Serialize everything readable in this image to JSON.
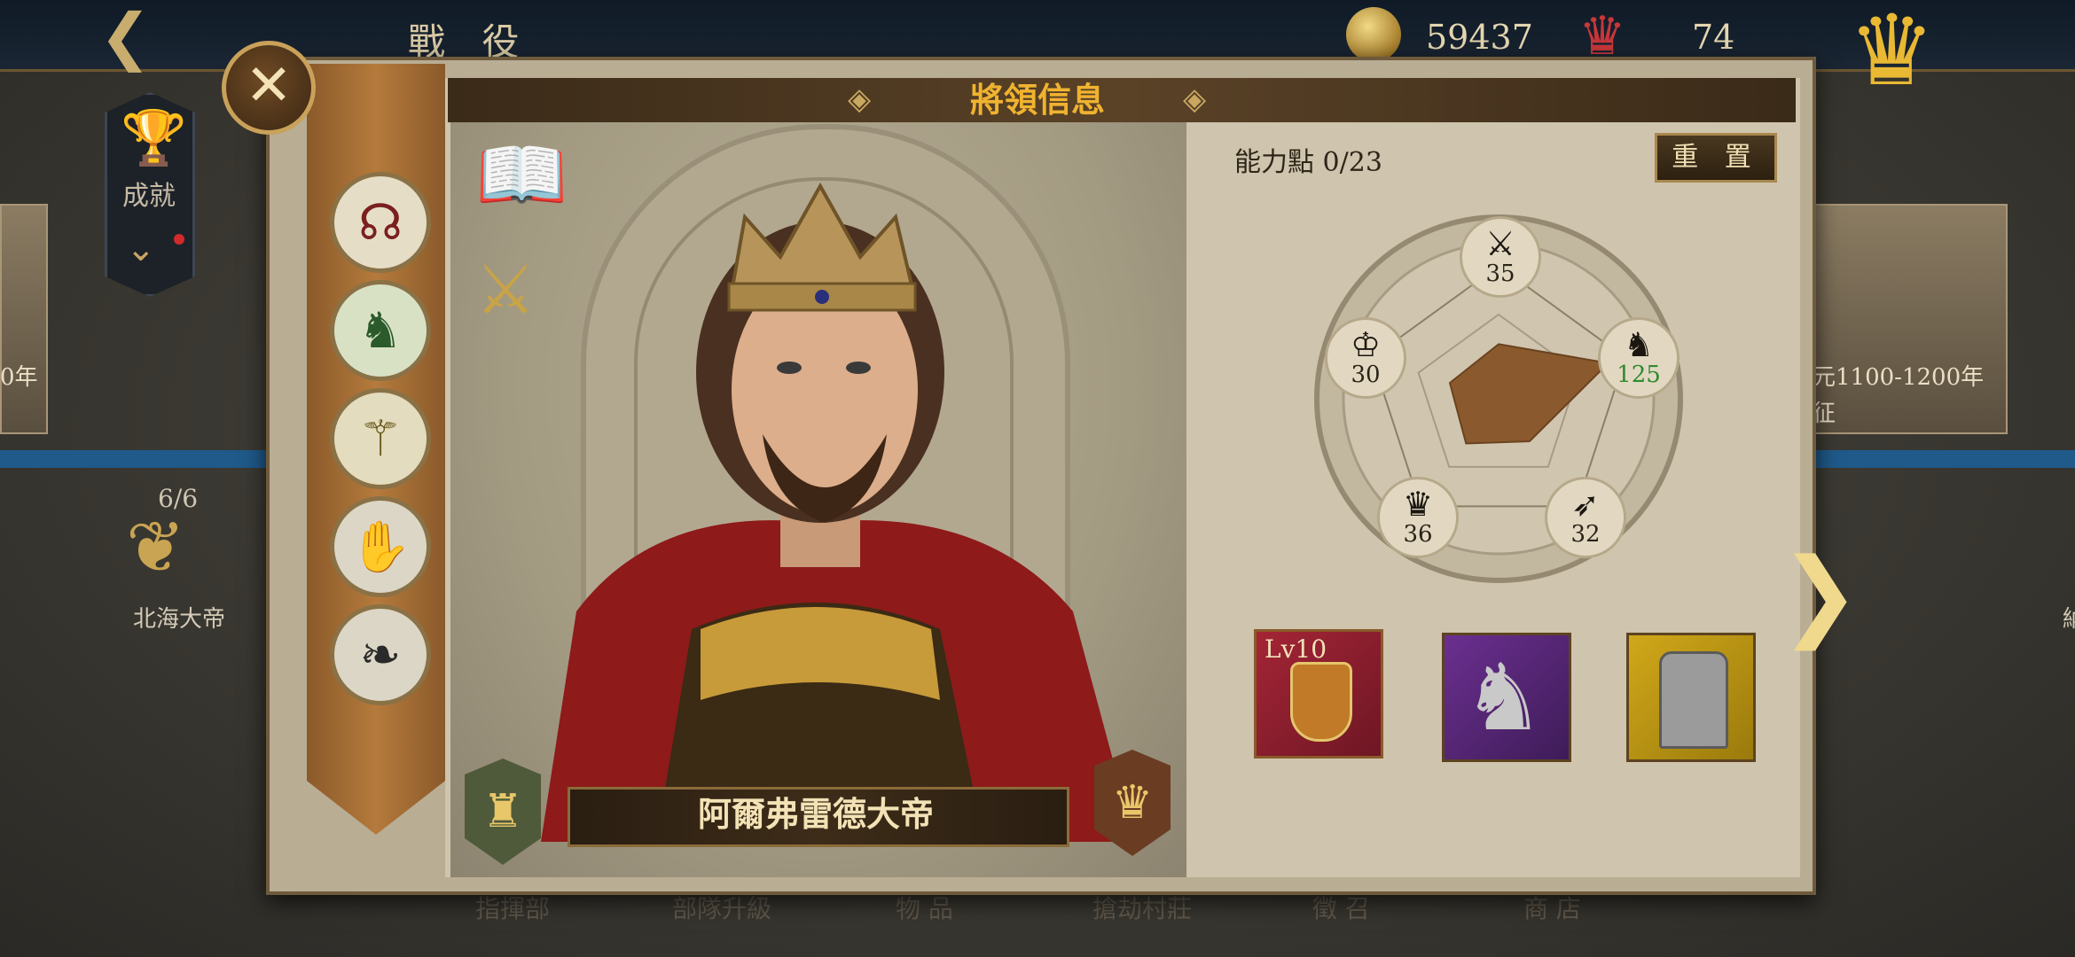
{
  "topbar": {
    "back_icon": "back-arrow-icon",
    "title": "戰 役",
    "coin_count": "59437",
    "crown_count": "74"
  },
  "background": {
    "achievement_label": "成就",
    "progress": "6/6",
    "left_hero_name": "北海大帝",
    "left_card_caption": "0年",
    "right_card_caption": "元1100-1200年",
    "right_card_sub": "征",
    "bottom_tabs": [
      "指揮部",
      "部隊升級",
      "物 品",
      "搶劫村莊",
      "徵 召",
      "商 店"
    ],
    "right_edge_char": "納"
  },
  "dialog": {
    "title": "將領信息",
    "close_icon": "close-x-icon",
    "general_name": "阿爾弗雷德大帝",
    "ability_points": "能力點 0/23",
    "reset_label": "重 置",
    "skills": [
      {
        "name": "knot-skill-icon",
        "glyph": "☊",
        "color": "#7a1f1f"
      },
      {
        "name": "knight-skill-icon",
        "glyph": "♞",
        "color": "#2b5a2b"
      },
      {
        "name": "halberd-skill-icon",
        "glyph": "⚚",
        "color": "#6b5a1e"
      },
      {
        "name": "hand-skill-icon",
        "glyph": "✋",
        "color": "#2a2a2a"
      },
      {
        "name": "wing-skill-icon",
        "glyph": "❧",
        "color": "#2a2a2a"
      }
    ],
    "stats": [
      {
        "key": "attack",
        "icon": "⚔",
        "value": "35",
        "color": "#2b2418"
      },
      {
        "key": "cavalry",
        "icon": "♞",
        "value": "125",
        "color": "#2f8a2f"
      },
      {
        "key": "archery",
        "icon": "➶",
        "value": "32",
        "color": "#2b2418"
      },
      {
        "key": "defense",
        "icon": "♛",
        "value": "36",
        "color": "#2b2418"
      },
      {
        "key": "leadership",
        "icon": "♔",
        "value": "30",
        "color": "#2b2418"
      }
    ],
    "equipment": [
      {
        "slot": "shield",
        "level": "Lv10",
        "bg": "#8a1e2c"
      },
      {
        "slot": "horse",
        "bg": "#5a2a7a"
      },
      {
        "slot": "armor",
        "bg": "#b8920f"
      }
    ]
  }
}
